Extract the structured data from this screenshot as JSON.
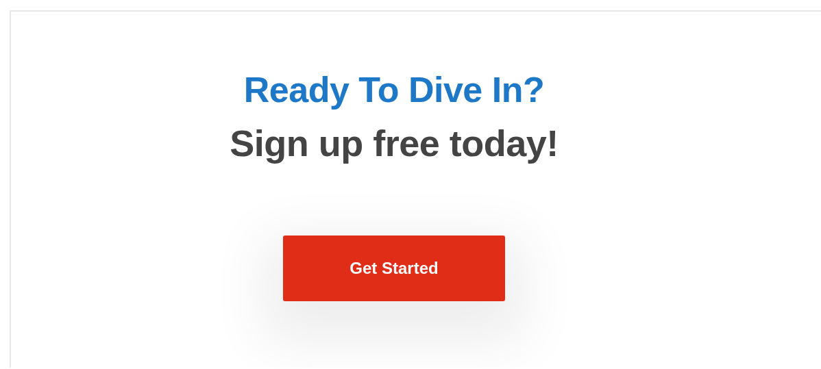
{
  "heading": "Ready To Dive In?",
  "subheading": "Sign up free today!",
  "button": {
    "label": "Get Started"
  }
}
